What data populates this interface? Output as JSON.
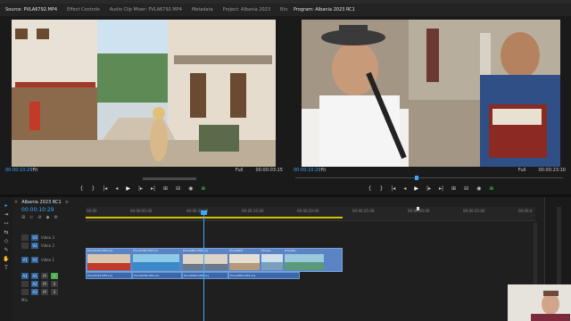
{
  "source_tabs": [
    "Source: PVLA6792.MP4",
    "Effect Controls",
    "Audio Clip Mixer: PVLA6792.MP4",
    "Metadata",
    "Project: Albania 2023",
    "Bin: media"
  ],
  "source": {
    "timecode_in": "00:00:10:29",
    "fit": "Fit",
    "quality": "Full",
    "duration": "00:00:03:15"
  },
  "program": {
    "tab": "Program: Albania 2023 RC1",
    "timecode": "00:00:10:29",
    "fit": "Fit",
    "quality": "Full",
    "duration": "00:00:23:10"
  },
  "transport_icons": [
    "◂",
    "{",
    "}",
    "|◂",
    "◂|",
    "▶",
    "|▸",
    "▸|",
    "⊞",
    "⊟",
    "◉",
    "⊕"
  ],
  "timeline": {
    "sequence_tab": "Albania 2023 RC1",
    "timecode": "00:00:10:29",
    "ruler": [
      "00:00",
      "00:00:05:00",
      "00:00:10:00",
      "00:00:15:00",
      "00:00:20:00",
      "00:00:25:00",
      "00:00:30:00",
      "00:00:35:00",
      "00:00:4"
    ],
    "tracks": [
      {
        "id": "V3",
        "name": "Video 3"
      },
      {
        "id": "V2",
        "name": "Video 2"
      },
      {
        "id": "V1",
        "name": "Video 1"
      },
      {
        "id": "A1",
        "name": ""
      },
      {
        "id": "A2",
        "name": ""
      },
      {
        "id": "A3",
        "name": ""
      },
      {
        "id": "Mix",
        "name": "Mix"
      }
    ],
    "video_clips": [
      "PVLA6792.MP4 [V]",
      "PVLA6768.MP4 [V]",
      "PVLA6802.MP4 [V]",
      "PVLA6803",
      "PVLA6...",
      "PVLA69..."
    ],
    "audio_clips": [
      "PVLA6792.MP4 [A]",
      "PVLA6768.MP4 [A]",
      "PVLA6802.MP4 [A]",
      "PVLA6803.MP4 [A]"
    ]
  },
  "tools": [
    "▸",
    "⇥",
    "⇿",
    "⇆",
    "◇",
    "✎",
    "✋",
    "T"
  ],
  "colors": {
    "accent": "#3ea6ff",
    "clip": "#5b84c4",
    "workbar": "#d4c000",
    "transport_hl": "#3ad34a"
  }
}
